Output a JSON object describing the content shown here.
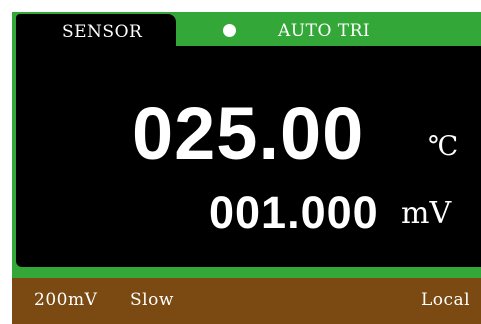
{
  "header": {
    "tab_label": "SENSOR",
    "trigger_label": "AUTO TRI"
  },
  "reading": {
    "primary_value": "025.00",
    "primary_unit": "℃",
    "secondary_value": "001.000",
    "secondary_unit": "mV"
  },
  "status": {
    "range": "200mV",
    "speed": "Slow",
    "mode": "Local"
  },
  "colors": {
    "frame": "#33a838",
    "display": "#000000",
    "status_bar": "#7a4a12",
    "text": "#ffffff"
  },
  "icons": {
    "trigger_indicator": "status-dot-icon"
  }
}
